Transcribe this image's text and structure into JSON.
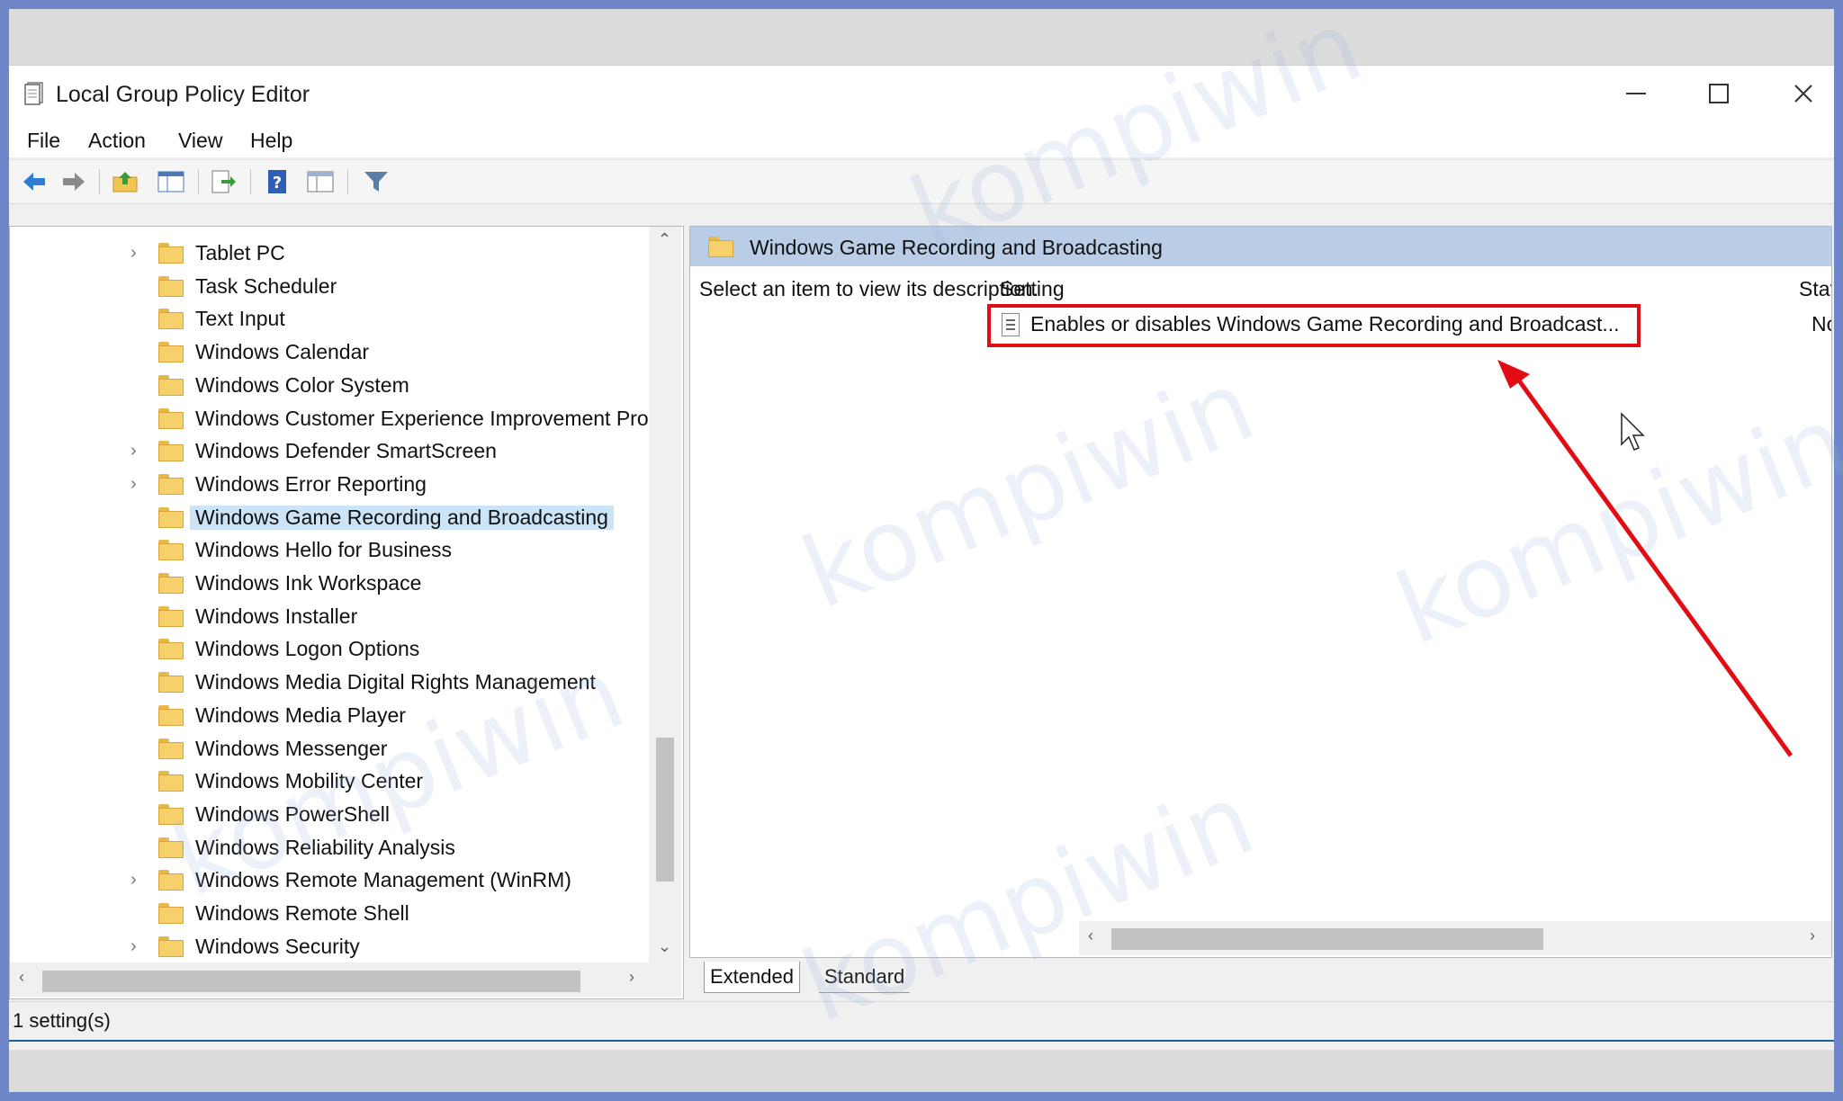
{
  "window": {
    "title": "Local Group Policy Editor",
    "controls": {
      "minimize": "minimize",
      "maximize": "maximize",
      "close": "close"
    }
  },
  "menu": {
    "items": [
      "File",
      "Action",
      "View",
      "Help"
    ]
  },
  "toolbar": {
    "icons": [
      "back-arrow-icon",
      "forward-arrow-icon",
      "up-folder-icon",
      "show-hide-tree-icon",
      "export-list-icon",
      "help-icon",
      "properties-icon",
      "filter-icon"
    ]
  },
  "tree": {
    "items": [
      {
        "label": "Tablet PC",
        "expandable": true
      },
      {
        "label": "Task Scheduler",
        "expandable": false
      },
      {
        "label": "Text Input",
        "expandable": false
      },
      {
        "label": "Windows Calendar",
        "expandable": false
      },
      {
        "label": "Windows Color System",
        "expandable": false
      },
      {
        "label": "Windows Customer Experience Improvement Pro",
        "expandable": false
      },
      {
        "label": "Windows Defender SmartScreen",
        "expandable": true
      },
      {
        "label": "Windows Error Reporting",
        "expandable": true
      },
      {
        "label": "Windows Game Recording and Broadcasting",
        "expandable": false,
        "selected": true
      },
      {
        "label": "Windows Hello for Business",
        "expandable": false
      },
      {
        "label": "Windows Ink Workspace",
        "expandable": false
      },
      {
        "label": "Windows Installer",
        "expandable": false
      },
      {
        "label": "Windows Logon Options",
        "expandable": false
      },
      {
        "label": "Windows Media Digital Rights Management",
        "expandable": false
      },
      {
        "label": "Windows Media Player",
        "expandable": false
      },
      {
        "label": "Windows Messenger",
        "expandable": false
      },
      {
        "label": "Windows Mobility Center",
        "expandable": false
      },
      {
        "label": "Windows PowerShell",
        "expandable": false
      },
      {
        "label": "Windows Reliability Analysis",
        "expandable": false
      },
      {
        "label": "Windows Remote Management (WinRM)",
        "expandable": true
      },
      {
        "label": "Windows Remote Shell",
        "expandable": false
      },
      {
        "label": "Windows Security",
        "expandable": true
      }
    ]
  },
  "details": {
    "header": "Windows Game Recording and Broadcasting",
    "description": "Select an item to view its description.",
    "columns": {
      "setting": "Setting",
      "state": "State"
    },
    "rows": [
      {
        "setting": "Enables or disables Windows Game Recording and Broadcast...",
        "state": "Not confi"
      }
    ]
  },
  "tabs": {
    "extended": "Extended",
    "standard": "Standard"
  },
  "status": {
    "text": "1 setting(s)"
  },
  "watermark": {
    "text": "kompiwin"
  },
  "colors": {
    "highlight": "#e20d14",
    "selection": "#cce4f7",
    "header": "#b9cde6",
    "border": "#6f87c8"
  }
}
